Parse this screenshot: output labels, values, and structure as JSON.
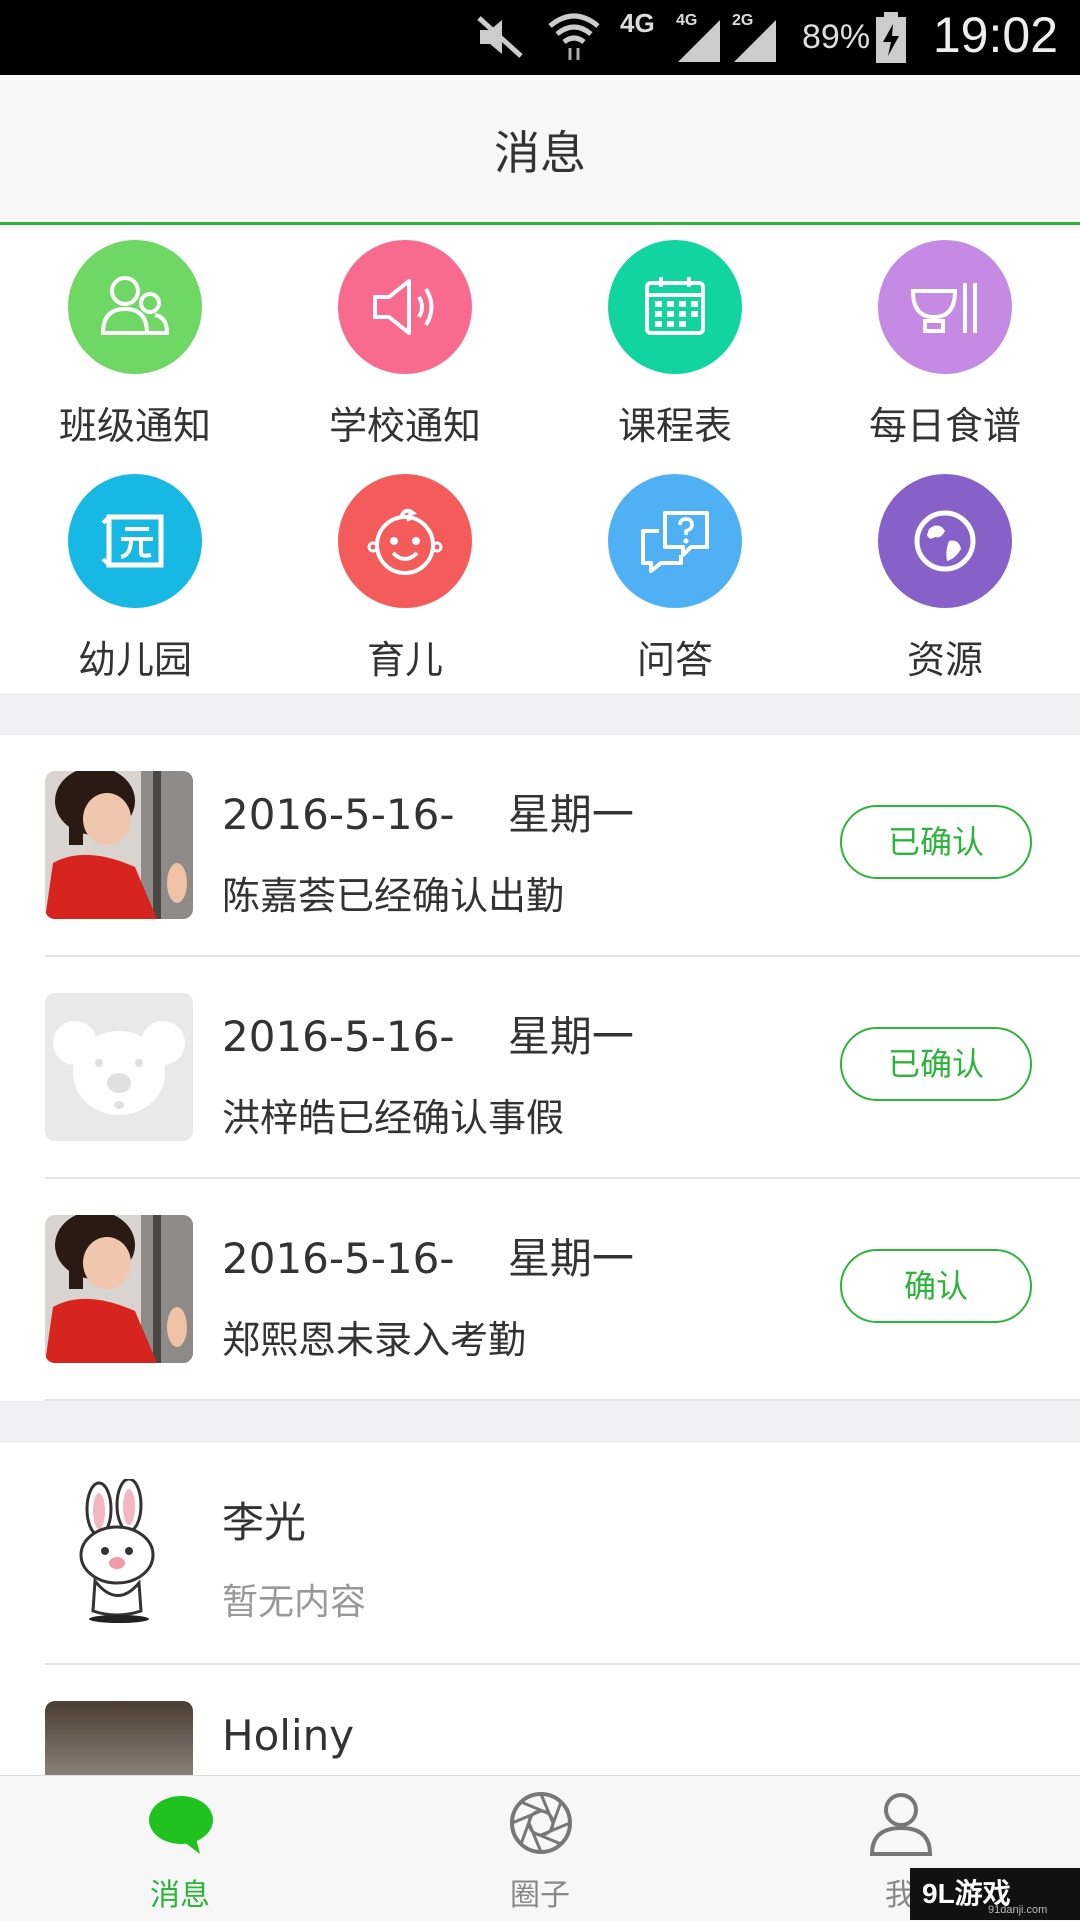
{
  "status_bar": {
    "network_4g": "4G",
    "network_4g_small": "4G",
    "network_2g_small": "2G",
    "battery": "89%",
    "time": "19:02"
  },
  "header": {
    "title": "消息"
  },
  "grid": [
    {
      "label": "班级通知",
      "icon": "class-notice-icon",
      "color": "#6fd864"
    },
    {
      "label": "学校通知",
      "icon": "school-notice-icon",
      "color": "#f86a8e"
    },
    {
      "label": "课程表",
      "icon": "calendar-icon",
      "color": "#12d4a1"
    },
    {
      "label": "每日食谱",
      "icon": "food-bowl-icon",
      "color": "#c48ae4"
    },
    {
      "label": "幼儿园",
      "icon": "kindergarten-icon",
      "color": "#17b8e3"
    },
    {
      "label": "育儿",
      "icon": "baby-face-icon",
      "color": "#f45b5b"
    },
    {
      "label": "问答",
      "icon": "qa-chat-icon",
      "color": "#4fb1f4"
    },
    {
      "label": "资源",
      "icon": "resource-globe-icon",
      "color": "#8662c8"
    }
  ],
  "attendance": [
    {
      "date": "2016-5-16-    星期一",
      "message": "陈嘉荟已经确认出勤",
      "button": "已确认",
      "avatar": "child-photo"
    },
    {
      "date": "2016-5-16-    星期一",
      "message": "洪梓皓已经确认事假",
      "button": "已确认",
      "avatar": "koala-placeholder"
    },
    {
      "date": "2016-5-16-    星期一",
      "message": "郑熙恩未录入考勤",
      "button": "确认",
      "avatar": "child-photo"
    }
  ],
  "chats": [
    {
      "name": "李光",
      "preview": "暂无内容",
      "avatar": "rabbit-avatar"
    },
    {
      "name": "Holiny",
      "preview": "",
      "avatar": "dark-photo"
    }
  ],
  "tabs": [
    {
      "label": "消息",
      "icon": "chat-bubble-icon",
      "active": true
    },
    {
      "label": "圈子",
      "icon": "aperture-icon",
      "active": false
    },
    {
      "label": "我",
      "icon": "person-icon",
      "active": false
    }
  ],
  "watermark": {
    "brand": "9L游戏",
    "url": "91danji.com"
  },
  "colors": {
    "accent": "#2db43a",
    "separator": "#efeff4"
  }
}
